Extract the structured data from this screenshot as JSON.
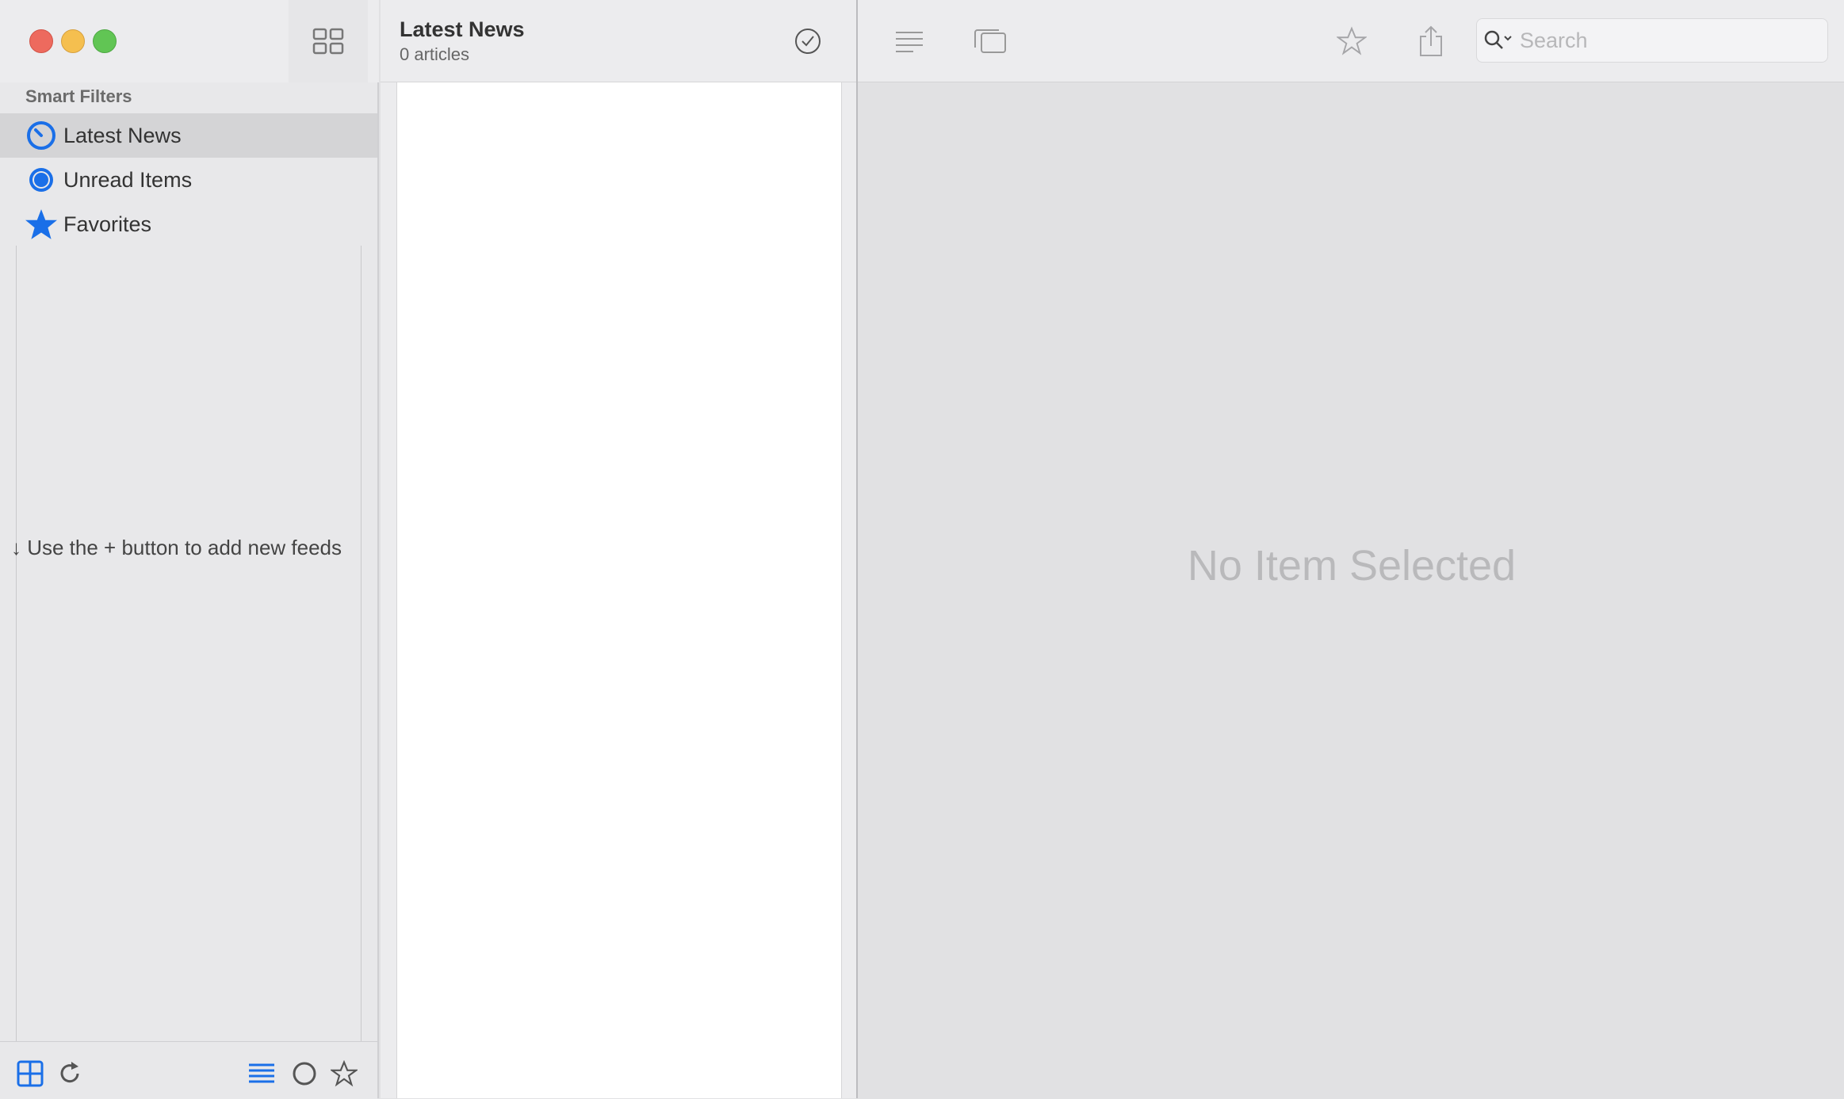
{
  "sidebar": {
    "section_header": "Smart Filters",
    "filters": [
      {
        "label": "Latest News",
        "icon": "clock-icon"
      },
      {
        "label": "Unread Items",
        "icon": "circle-icon"
      },
      {
        "label": "Favorites",
        "icon": "star-icon"
      }
    ],
    "add_hint": "↓ Use the + button to add new feeds"
  },
  "article_list": {
    "title": "Latest News",
    "subtitle": "0 articles"
  },
  "search": {
    "placeholder": "Search"
  },
  "detail": {
    "empty_text": "No Item Selected"
  },
  "colors": {
    "accent": "#1a6fe8",
    "close": "#ed6a5e",
    "minimize": "#f5bf4f",
    "maximize": "#61c554"
  }
}
